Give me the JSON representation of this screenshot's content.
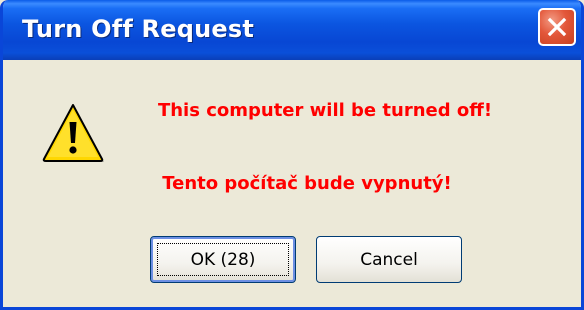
{
  "window": {
    "title": "Turn Off Request",
    "close_icon": "close-icon"
  },
  "dialog": {
    "icon": "warning-icon",
    "message_en": "This computer will be turned off!",
    "message_sk": "Tento počítač bude vypnutý!",
    "message_color": "#ff0000"
  },
  "buttons": {
    "ok_label": "OK (28)",
    "cancel_label": "Cancel"
  },
  "colors": {
    "titlebar": "#0a55e0",
    "close_button": "#e3573a",
    "face": "#ece9d8"
  }
}
